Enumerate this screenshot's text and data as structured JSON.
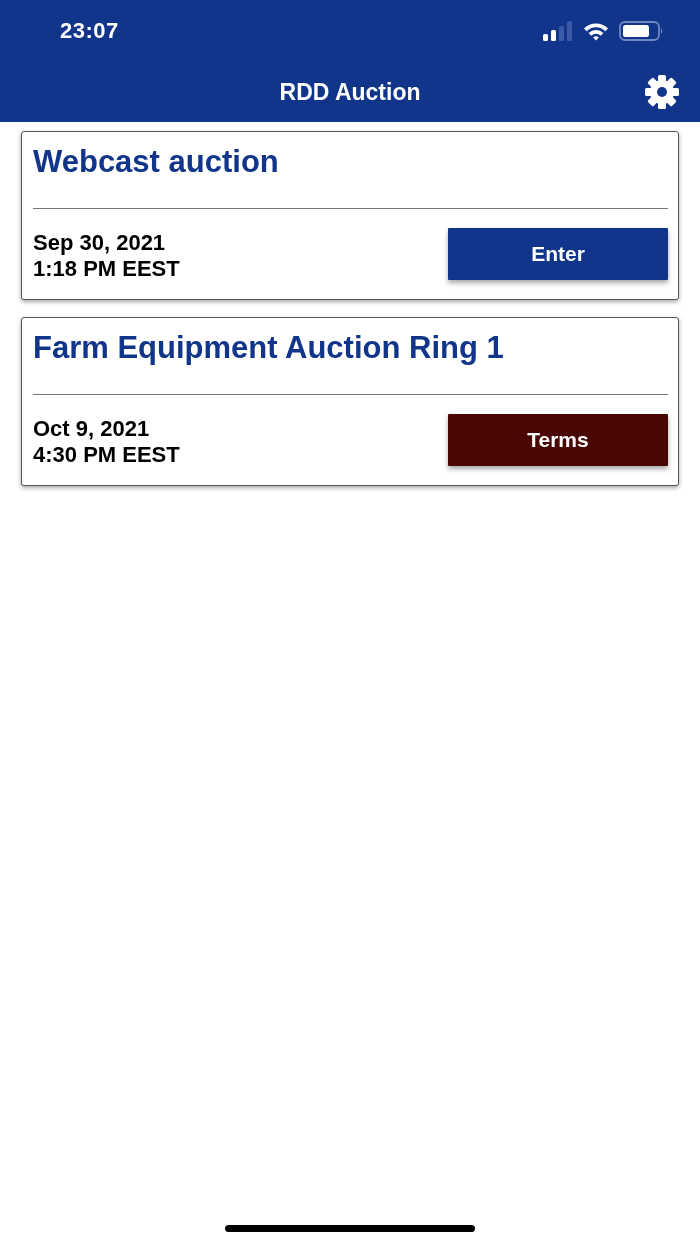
{
  "status_bar": {
    "time": "23:07"
  },
  "nav_bar": {
    "title": "RDD Auction"
  },
  "auctions": [
    {
      "title": "Webcast auction",
      "date": "Sep 30, 2021",
      "time": "1:18 PM EEST",
      "button": {
        "label": "Enter",
        "kind": "enter"
      }
    },
    {
      "title": "Farm Equipment Auction Ring 1",
      "date": "Oct 9, 2021",
      "time": "4:30 PM EEST",
      "button": {
        "label": "Terms",
        "kind": "terms"
      }
    }
  ]
}
